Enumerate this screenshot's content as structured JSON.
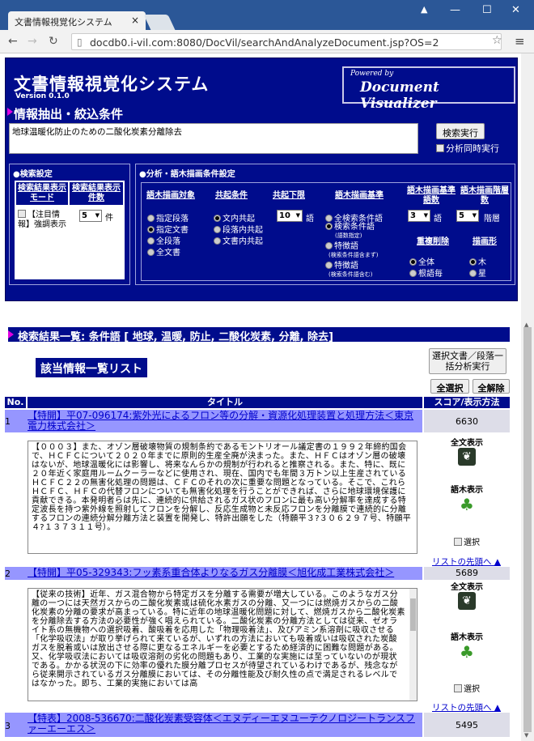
{
  "browser": {
    "tab_title": "文書情報視覚化システム",
    "url": "docdb0.i-vil.com:8080/DocVil/searchAndAnalyzeDocument.jsp?OS=2"
  },
  "header": {
    "title": "文書情報視覚化システム",
    "version": "Version 0.1.0",
    "powered": "Powered by",
    "product": "Document Visualizer"
  },
  "search": {
    "section_title": "情報抽出・絞込条件",
    "query": "地球温暖化防止のための二酸化炭素分離除去",
    "run_button": "検索実行",
    "simul_label": "分析同時実行"
  },
  "search_settings": {
    "title": "●検索設定",
    "col1": "検索結果表示モード",
    "col2": "検索結果表示件数",
    "highlight_label": "【注目情報】強調表示",
    "count_value": "5",
    "count_unit": "件"
  },
  "analysis": {
    "title": "●分析・語木描画条件設定",
    "cols": [
      "語木描画対象",
      "共起条件",
      "共起下限",
      "語木描画基準",
      "語木描画基準語数",
      "語木描画階層数"
    ],
    "target_opts": [
      "指定段落",
      "指定文書",
      "全段落",
      "全文書"
    ],
    "cooc_opts": [
      "文内共起",
      "段落内共起",
      "文書内共起"
    ],
    "cooc_min": "10",
    "cooc_unit": "語",
    "basis_opts": [
      "全検索条件語",
      "検索条件語",
      "(語数指定)",
      "特徴語",
      "(検索条件語含まず)",
      "特徴語",
      "(検索条件語含む)"
    ],
    "basis_count": "3",
    "basis_unit": "語",
    "levels": "5",
    "levels_unit": "階層",
    "dup_title": "重複削除",
    "shape_title": "描画形",
    "dup_opts": [
      "全体",
      "根語毎"
    ],
    "shape_opts": [
      "木",
      "星"
    ]
  },
  "results": {
    "header": "検索結果一覧:  条件語  [ 地球, 温暖, 防止, 二酸化炭素, 分離, 除去]",
    "list_title": "該当情報一覧リスト",
    "batch_button": "選択文書／段落一括分析実行",
    "select_all": "全選択",
    "deselect_all": "全解除",
    "col_no": "No.",
    "col_title": "タイトル",
    "col_score": "スコア/表示方法",
    "fulltext": "全文表示",
    "tree": "語木表示",
    "select": "選択",
    "back_to_top": "リストの先頭へ ▲",
    "rows": [
      {
        "no": "1",
        "title": "【特開】平07-096174:紫外光によるフロン等の分解・資源化処理装置と処理方法＜東京電力株式会社＞",
        "score": "6630",
        "excerpt": "【０００３】また、オゾン層破壊物質の規制条約であるモントリオール議定書の１９９２年締約国会で、ＨＣＦＣについて２０２０年までに原則的生産全廃が決まった。また、ＨＦＣはオゾン層の破壊はないが、地球温暖化には影響し、将来なんらかの規制が行われると推察される。また、特に、既に２０年近く家庭用ルームクーラーなどに使用され、現在、国内でも年間３万トン以上生産されているＨＣＦＣ２２の無害化処理の問題は、ＣＦＣのそれの次に重要な問題となっている。そこで、これらＨＣＦＣ、ＨＦＣの代替フロンについても無害化処理を行うことができれば、さらに地球環境保護に貢献できる。本発明者らは先に、連続的に供給されるガス状のフロンに最も高い分解率を達成する特定波長を持つ紫外線を照射してフロンを分解し、反応生成物と未反応フロンを分離膜で連続的に分離するフロンの連続分解分離方法と装置を開発し、特許出願をした（特願平３?３０６２９７号、特願平４?１３７３１１号）。"
      },
      {
        "no": "2",
        "title": "【特開】平05-329343:フッ素系重合体よりなるガス分離膜＜旭化成工業株式会社＞",
        "score": "5689",
        "excerpt": "【従来の技術】近年、ガス混合物から特定ガスを分離する需要が増大している。このようなガス分離の一つには天然ガスからの二酸化炭素或は硫化水素ガスの分離、又一つには燃焼ガスからの二酸化炭素の分離の要求が高まっている。特に近年の地球温暖化問題に対して、燃焼ガスから二酸化炭素を分離除去する方法の必要性が強く唱えられている。二酸化炭素の分離方法としては従来、ゼオライト系の無機物への選択吸着、酸吸着を応用した「物理吸着法」、及びアミン系溶剤に吸収させる「化学吸収法」が取り挙げられて来ているが、いずれの方法においても吸着或いは吸収された炭酸ガスを脱着或いは放出させる際に更なるエネルギーを必要とするため経済的に困難な問題がある。又、化学吸収法においては吸収溶剤の劣化の問題もあり、工業的な実施には至っていないのが現状である。かかる状況の下に効率の優れた膜分離プロセスが待望されているわけであるが、残念ながら従来開示されているガス分離膜においては、その分離性能及び耐久性の点で満足されるレベルではなかった。即ち、工業的実施においては高"
      },
      {
        "no": "3",
        "title": "【特表】2008-536670:二酸化炭素受容体＜エヌディーエヌユーテクノロジートランスファーエーエス＞",
        "score": "5495"
      }
    ]
  }
}
